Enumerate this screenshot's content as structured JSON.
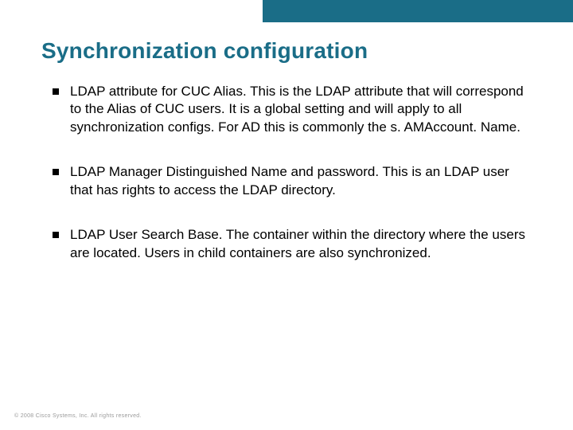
{
  "colors": {
    "accent": "#1a6d87"
  },
  "slide": {
    "title": "Synchronization configuration",
    "bullets": [
      "LDAP attribute for CUC Alias. This is the LDAP attribute that will correspond to the Alias of CUC users. It is a global setting and will apply to all synchronization configs. For AD this is commonly the s. AMAccount. Name.",
      "LDAP Manager Distinguished Name and password. This is an LDAP user that has rights to access the LDAP directory.",
      "LDAP User Search Base. The container within the directory where the users are located. Users in child containers are also synchronized."
    ]
  },
  "footer": "© 2008 Cisco Systems, Inc. All rights reserved."
}
